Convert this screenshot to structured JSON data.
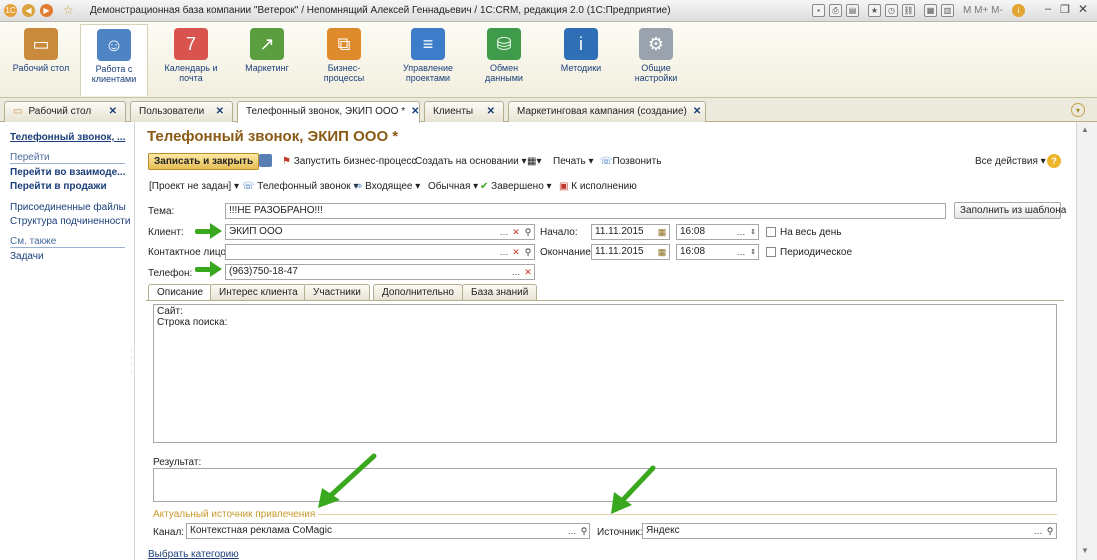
{
  "window": {
    "title": "Демонстрационная база компании \"Ветерок\" / Непомнящий Алексей Геннадьевич / 1С:CRM, редакция 2.0  (1С:Предприятие)",
    "m_buttons": [
      "M",
      "M+",
      "M-"
    ]
  },
  "sections": [
    {
      "label": "Рабочий стол",
      "icon": "desk-icon",
      "color": "#c98b3b"
    },
    {
      "label": "Работа с клиентами",
      "icon": "handshake-icon",
      "color": "#4e84c4"
    },
    {
      "label": "Календарь и почта",
      "icon": "calendar-icon",
      "color": "#d9534f"
    },
    {
      "label": "Маркетинг",
      "icon": "chart-icon",
      "color": "#5a9e3f"
    },
    {
      "label": "Бизнес-процессы",
      "icon": "process-icon",
      "color": "#e08a2e"
    },
    {
      "label": "Управление проектами",
      "icon": "gantt-icon",
      "color": "#3d7cc9"
    },
    {
      "label": "Обмен данными",
      "icon": "database-icon",
      "color": "#3f9a4a"
    },
    {
      "label": "Методики",
      "icon": "info-book-icon",
      "color": "#2f6fb5"
    },
    {
      "label": "Общие настройки",
      "icon": "gears-icon",
      "color": "#9aa3ad"
    }
  ],
  "tabs": [
    {
      "label": "Рабочий стол"
    },
    {
      "label": "Пользователи"
    },
    {
      "label": "Телефонный звонок, ЭКИП ООО *"
    },
    {
      "label": "Клиенты"
    },
    {
      "label": "Маркетинговая кампания (создание)"
    }
  ],
  "leftnav": {
    "current": "Телефонный звонок, ...",
    "goto_header": "Перейти",
    "goto_items": [
      "Перейти во взаимоде...",
      "Перейти в продажи"
    ],
    "other_items": [
      "Присоединенные файлы",
      "Структура подчиненности"
    ],
    "see_also_header": "См. также",
    "see_also_items": [
      "Задачи"
    ]
  },
  "form": {
    "title": "Телефонный звонок, ЭКИП ООО *",
    "toolbar": {
      "save_close": "Записать и закрыть",
      "start_bp": "Запустить бизнес-процесс",
      "create_based": "Создать на основании",
      "print": "Печать",
      "call": "Позвонить",
      "all_actions": "Все действия",
      "help": "?"
    },
    "toolbar2": {
      "project": "[Проект не задан]",
      "type": "Телефонный звонок",
      "direction": "Входящее",
      "importance": "Обычная",
      "state": "Завершено",
      "execute": "К исполнению"
    },
    "fields": {
      "theme_label": "Тема:",
      "theme_value": "!!!НЕ РАЗОБРАНО!!!",
      "fill_template": "Заполнить из шаблона",
      "client_label": "Клиент:",
      "client_value": "ЭКИП ООО",
      "contact_label": "Контактное лицо:",
      "contact_value": "",
      "phone_label": "Телефон:",
      "phone_value": "(963)750-18-47",
      "start_label": "Начало:",
      "start_date": "11.11.2015",
      "start_time": "16:08",
      "end_label": "Окончание:",
      "end_date": "11.11.2015",
      "end_time": "16:08",
      "all_day": "На весь день",
      "periodic": "Периодическое"
    },
    "form_tabs": [
      "Описание",
      "Интерес клиента",
      "Участники",
      "Дополнительно",
      "База знаний"
    ],
    "description_text": [
      "Сайт:",
      "Строка поиска:"
    ],
    "result_label": "Результат:",
    "source_group": "Актуальный источник привлечения",
    "channel_label": "Канал:",
    "channel_value": "Контекстная реклама CoMagic",
    "source_label": "Источник:",
    "source_value": "Яндекс",
    "category_link": "Выбрать категорию"
  }
}
